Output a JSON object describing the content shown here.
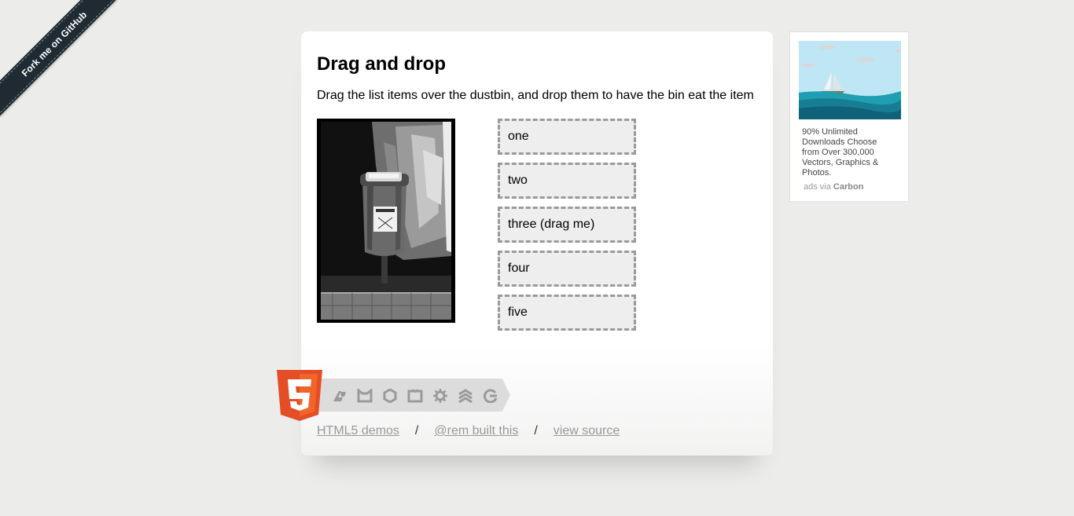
{
  "ribbon": {
    "label": "Fork me on GitHub"
  },
  "page": {
    "title": "Drag and drop",
    "description": "Drag the list items over the dustbin, and drop them to have the bin eat the item"
  },
  "items": [
    "one",
    "two",
    "three (drag me)",
    "four",
    "five"
  ],
  "badge": {
    "logo_digit": "5",
    "icons": [
      "semantics-icon",
      "offline-storage-icon",
      "device-access-icon",
      "connectivity-icon",
      "performance-icon",
      "css3-styling-icon",
      "multimedia-icon"
    ]
  },
  "footer": {
    "link1": "HTML5 demos",
    "sep": "/",
    "link2": "@rem built this",
    "link3": "view source"
  },
  "ad": {
    "text": "90% Unlimited Downloads Choose from Over 300,000 Vectors, Graphics & Photos.",
    "via_prefix": "ads via",
    "via_brand": "Carbon"
  },
  "colors": {
    "background": "#ececeb",
    "html5_orange": "#e44d26",
    "ribbon": "#1f2a33"
  }
}
